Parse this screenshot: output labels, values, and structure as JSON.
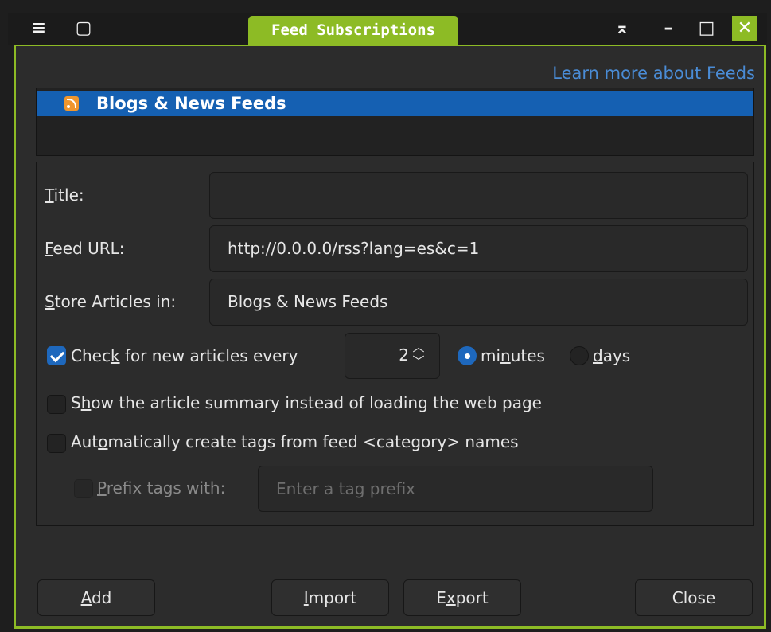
{
  "window": {
    "title": "Feed Subscriptions",
    "menu_icon": "menu-icon",
    "window_icon": "window-icon",
    "controls": [
      "keep-above-icon",
      "minimize-icon",
      "maximize-icon",
      "close-icon"
    ]
  },
  "learn_more": "Learn more about Feeds",
  "tree": {
    "items": [
      {
        "label": "Blogs & News Feeds",
        "icon": "rss-icon",
        "selected": true
      }
    ]
  },
  "form": {
    "title_label": {
      "mnemonic": "T",
      "rest": "itle:"
    },
    "title_value": "",
    "url_label": {
      "mnemonic": "F",
      "rest": "eed URL:"
    },
    "url_value": "http://0.0.0.0/rss?lang=es&c=1",
    "store_label": {
      "mnemonic": "S",
      "rest": "tore Articles in:"
    },
    "store_value": "Blogs & News Feeds",
    "check": {
      "pre": "Chec",
      "mnemonic": "k",
      "post": " for new articles every",
      "checked": true
    },
    "interval_value": "2",
    "minutes": {
      "pre": "mi",
      "mnemonic": "n",
      "post": "utes",
      "selected": true
    },
    "days": {
      "mnemonic": "d",
      "post": "ays",
      "selected": false
    },
    "summary": {
      "pre": "S",
      "mnemonic": "h",
      "post": "ow the article summary instead of loading the web page",
      "checked": false
    },
    "auto_tags": {
      "pre": "Aut",
      "mnemonic": "o",
      "post": "matically create tags from feed <category> names",
      "checked": false
    },
    "prefix": {
      "mnemonic": "P",
      "post": "refix tags with:",
      "checked": false,
      "enabled": false
    },
    "prefix_placeholder": "Enter a tag prefix"
  },
  "buttons": {
    "add": {
      "mnemonic": "A",
      "post": "dd"
    },
    "import": {
      "mnemonic": "I",
      "post": "mport"
    },
    "export": {
      "pre": "E",
      "mnemonic": "x",
      "post": "port"
    },
    "close": "Close"
  },
  "colors": {
    "accent": "#8dbb25",
    "selection": "#1560b2",
    "link": "#4a8cd6",
    "rss": "#f0962d"
  }
}
